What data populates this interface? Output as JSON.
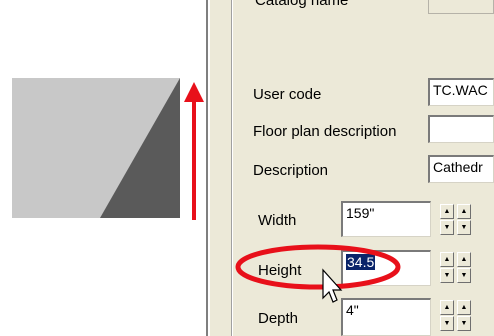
{
  "dialog": {
    "catalog_name_label": "Catalog name",
    "user_code_label": "User code",
    "user_code_value": "TC.WAC",
    "floor_plan_label": "Floor plan description",
    "floor_plan_value": "",
    "description_label": "Description",
    "description_value": "Cathedr",
    "width_label": "Width",
    "width_value": "159\"",
    "height_label": "Height",
    "height_value": "34.5",
    "depth_label": "Depth",
    "depth_value": "4\""
  },
  "colors": {
    "highlight_red": "#e8101a",
    "selection_blue": "#0a246a",
    "dialog_bg": "#ece9d8"
  },
  "icons": [
    "up-arrow-icon",
    "spin-up-icon",
    "spin-down-icon",
    "mouse-cursor-icon"
  ]
}
